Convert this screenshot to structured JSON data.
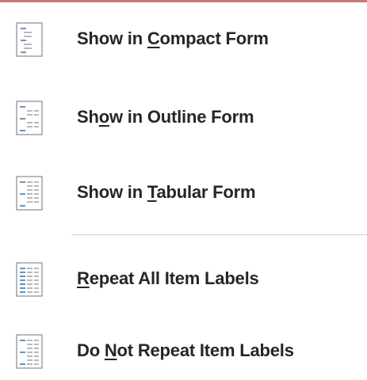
{
  "menu": {
    "items": [
      {
        "id": "compact",
        "pre": "Show in ",
        "key": "C",
        "post": "ompact Form",
        "icon": "compact-form-icon"
      },
      {
        "id": "outline",
        "pre": "Sh",
        "key": "o",
        "post": "w in Outline Form",
        "icon": "outline-form-icon"
      },
      {
        "id": "tabular",
        "pre": "Show in ",
        "key": "T",
        "post": "abular Form",
        "icon": "tabular-form-icon"
      },
      {
        "id": "repeat",
        "pre": "",
        "key": "R",
        "post": "epeat All Item Labels",
        "icon": "repeat-labels-icon"
      },
      {
        "id": "norepeat",
        "pre": "Do ",
        "key": "N",
        "post": "ot Repeat Item Labels",
        "icon": "no-repeat-labels-icon"
      }
    ]
  },
  "colors": {
    "top_border": "#c8787a",
    "text": "#262626",
    "icon_blue": "#2e75b6",
    "icon_gray": "#8a8a8a",
    "separator": "#d4d4d4"
  }
}
